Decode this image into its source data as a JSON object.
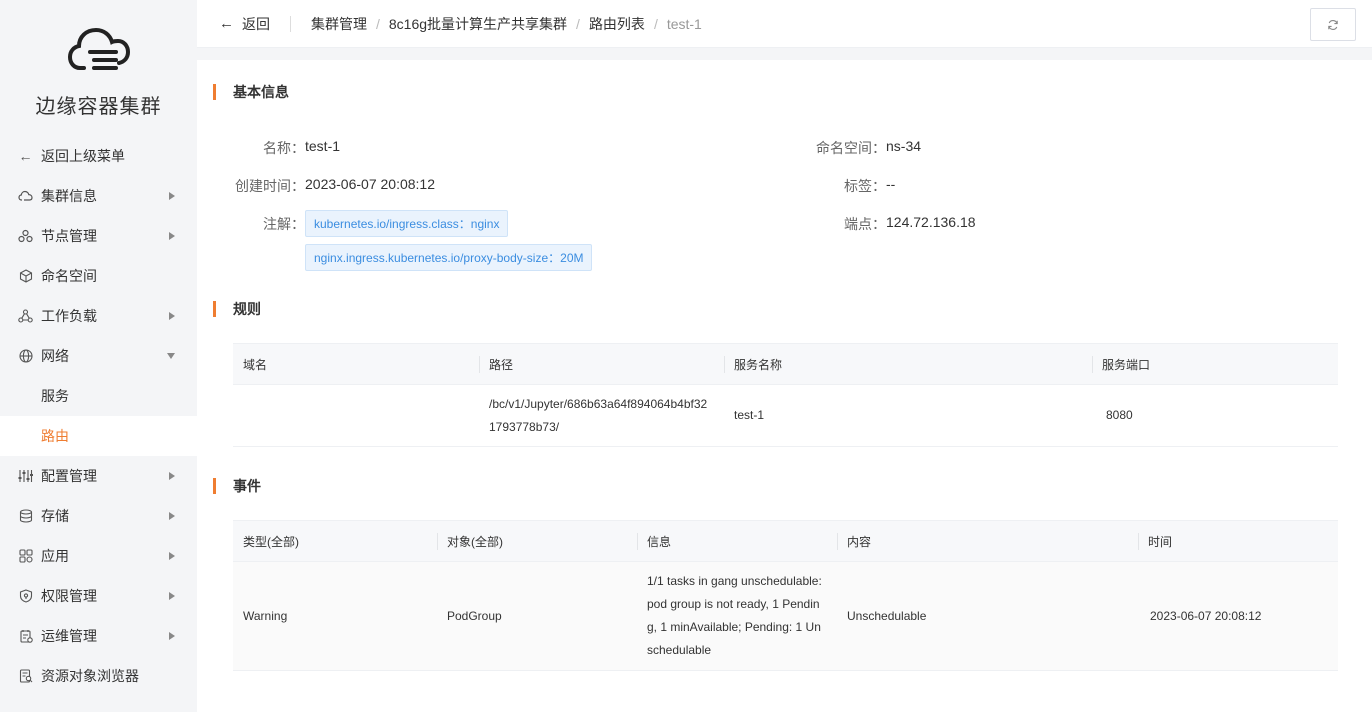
{
  "sidebar": {
    "title": "边缘容器集群",
    "back_label": "返回上级菜单",
    "items": [
      {
        "label": "集群信息",
        "icon": "cloud-icon",
        "caret": "right"
      },
      {
        "label": "节点管理",
        "icon": "nodes-icon",
        "caret": "right"
      },
      {
        "label": "命名空间",
        "icon": "namespace-icon",
        "caret": ""
      },
      {
        "label": "工作负载",
        "icon": "workload-icon",
        "caret": "right"
      },
      {
        "label": "网络",
        "icon": "globe-icon",
        "caret": "down"
      }
    ],
    "network_sub": [
      {
        "label": "服务",
        "active": false
      },
      {
        "label": "路由",
        "active": true
      }
    ],
    "items_after": [
      {
        "label": "配置管理",
        "icon": "sliders-icon",
        "caret": "right"
      },
      {
        "label": "存储",
        "icon": "database-icon",
        "caret": "right"
      },
      {
        "label": "应用",
        "icon": "apps-icon",
        "caret": "right"
      },
      {
        "label": "权限管理",
        "icon": "shield-icon",
        "caret": "right"
      },
      {
        "label": "运维管理",
        "icon": "ops-icon",
        "caret": "right"
      },
      {
        "label": "资源对象浏览器",
        "icon": "browser-icon",
        "caret": ""
      }
    ],
    "active_color": "#ef7d31"
  },
  "topbar": {
    "back_label": "返回",
    "breadcrumbs": [
      "集群管理",
      "8c16g批量计算生产共享集群",
      "路由列表",
      "test-1"
    ]
  },
  "basic": {
    "title": "基本信息",
    "name_label": "名称：",
    "name_value": "test-1",
    "created_label": "创建时间：",
    "created_value": "2023-06-07 20:08:12",
    "annotation_label": "注解：",
    "annotations": [
      {
        "key": "kubernetes.io/ingress.class",
        "value": "nginx"
      },
      {
        "key": "nginx.ingress.kubernetes.io/proxy-body-size",
        "value": "20M"
      }
    ],
    "namespace_label": "命名空间：",
    "namespace_value": "ns-34",
    "tags_label": "标签：",
    "tags_value": "--",
    "endpoint_label": "端点：",
    "endpoint_value": "124.72.136.18"
  },
  "rules": {
    "title": "规则",
    "headers": [
      "域名",
      "路径",
      "服务名称",
      "服务端口"
    ],
    "rows": [
      {
        "domain": "",
        "path_line1": "/bc/v1/Jupyter/686b63a64f894064b4bf32",
        "path_line2": "1793778b73/",
        "service": "test-1",
        "port": "8080"
      }
    ]
  },
  "events": {
    "title": "事件",
    "headers": [
      "类型(全部)",
      "对象(全部)",
      "信息",
      "内容",
      "时间"
    ],
    "rows": [
      {
        "type": "Warning",
        "object": "PodGroup",
        "message_lines": [
          "1/1 tasks in gang unschedulable:",
          "pod group is not ready, 1 Pendin",
          "g, 1 minAvailable; Pending: 1 Un",
          "schedulable"
        ],
        "content": "Unschedulable",
        "time": "2023-06-07 20:08:12"
      }
    ]
  }
}
